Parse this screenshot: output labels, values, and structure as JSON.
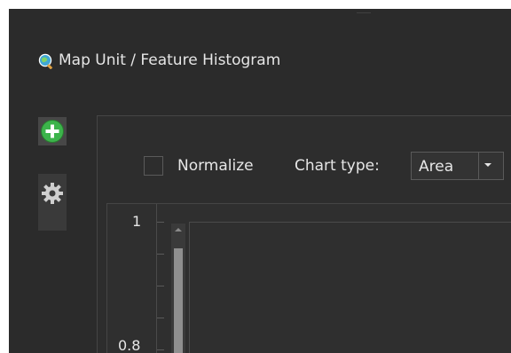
{
  "window": {
    "title": "Map Unit / Feature Histogram"
  },
  "sidebar": {
    "items": [
      {
        "name": "add",
        "icon": "add-icon"
      },
      {
        "name": "settings",
        "icon": "gear-icon"
      }
    ]
  },
  "toolbar": {
    "normalize_label": "Normalize",
    "chart_type_label": "Chart type:",
    "chart_type_value": "Area"
  },
  "chart": {
    "yticks": [
      "1",
      "0.8"
    ]
  },
  "colors": {
    "background": "#2b2b2b",
    "add_green": "#3cb44b",
    "text": "#e6e6e6"
  }
}
